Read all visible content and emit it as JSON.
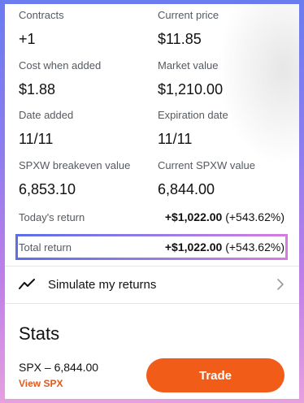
{
  "details": {
    "contracts": {
      "label": "Contracts",
      "value": "+1"
    },
    "current_price": {
      "label": "Current price",
      "value": "$11.85"
    },
    "cost_when_added": {
      "label": "Cost when added",
      "value": "$1.88"
    },
    "market_value": {
      "label": "Market value",
      "value": "$1,210.00"
    },
    "date_added": {
      "label": "Date added",
      "value": "11/11"
    },
    "expiration_date": {
      "label": "Expiration date",
      "value": "11/11"
    },
    "breakeven": {
      "label": "SPXW breakeven value",
      "value": "6,853.10"
    },
    "current_spxw": {
      "label": "Current SPXW value",
      "value": "6,844.00"
    }
  },
  "returns": {
    "today": {
      "label": "Today's return",
      "amount": "+$1,022.00",
      "percent": "(+543.62%)"
    },
    "total": {
      "label": "Total return",
      "amount": "+$1,022.00",
      "percent": "(+543.62%)"
    }
  },
  "simulate": {
    "label": "Simulate my returns"
  },
  "stats": {
    "title": "Stats",
    "underlying": "SPX – 6,844.00",
    "view_link": "View SPX",
    "trade_button": "Trade"
  },
  "colors": {
    "accent_orange": "#f25c19",
    "link_orange": "#e05a1f",
    "highlight_gradient_start": "#5b6ee8",
    "highlight_gradient_end": "#d77be0"
  },
  "icons": {
    "simulate": "line-chart-icon",
    "row_arrow": "chevron-right-icon"
  }
}
